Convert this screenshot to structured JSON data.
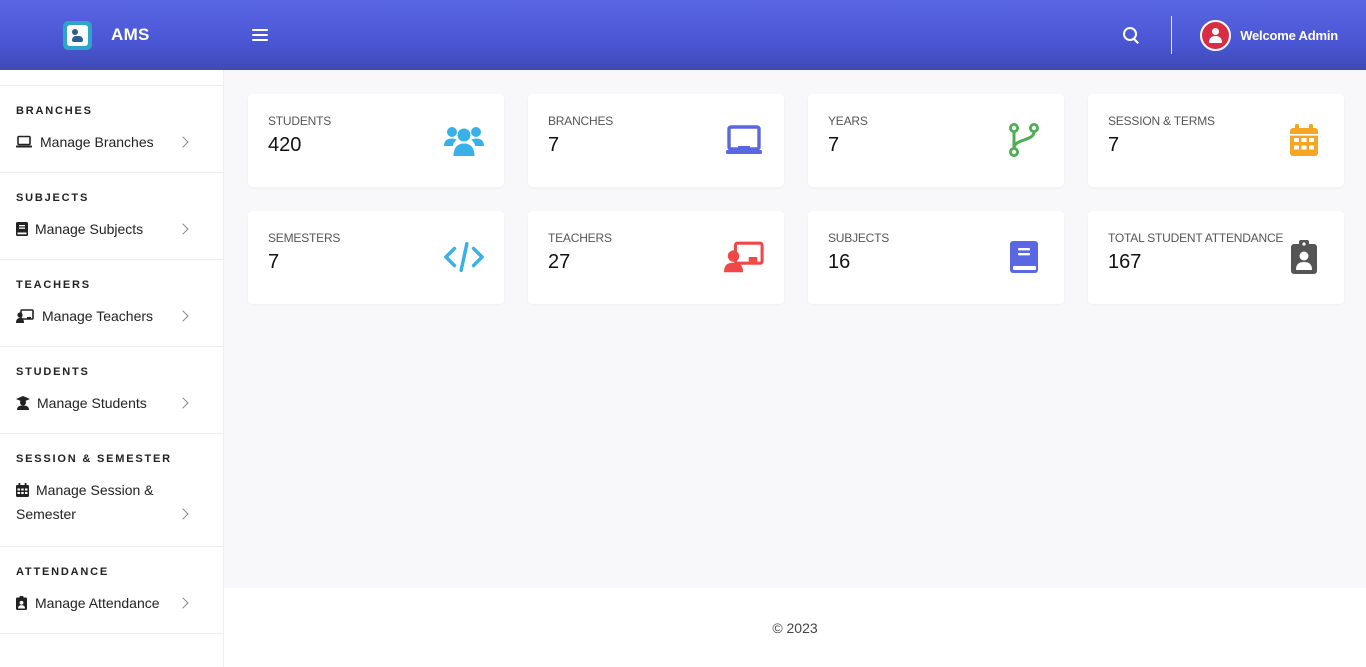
{
  "header": {
    "brand": "AMS",
    "welcome": "Welcome Admin"
  },
  "sidebar": {
    "sections": [
      {
        "title": "BRANCHES",
        "item": "Manage Branches",
        "icon": "laptop-icon"
      },
      {
        "title": "SUBJECTS",
        "item": "Manage Subjects",
        "icon": "book-icon"
      },
      {
        "title": "TEACHERS",
        "item": "Manage Teachers",
        "icon": "chalkboard-teacher-icon"
      },
      {
        "title": "STUDENTS",
        "item": "Manage Students",
        "icon": "graduate-icon"
      },
      {
        "title": "SESSION & SEMESTER",
        "item_line1": "Manage Session &",
        "item_line2": "Semester",
        "icon": "calendar-icon"
      },
      {
        "title": "ATTENDANCE",
        "item": "Manage Attendance",
        "icon": "clipboard-user-icon"
      }
    ]
  },
  "cards": [
    {
      "label": "STUDENTS",
      "value": "420",
      "icon": "users-icon",
      "color": "#3ab0e8"
    },
    {
      "label": "BRANCHES",
      "value": "7",
      "icon": "chalkboard-icon",
      "color": "#5a67e3"
    },
    {
      "label": "YEARS",
      "value": "7",
      "icon": "code-branch-icon",
      "color": "#4caf50"
    },
    {
      "label": "SESSION & TERMS",
      "value": "7",
      "icon": "calendar-icon",
      "color": "#f5a623"
    },
    {
      "label": "SEMESTERS",
      "value": "7",
      "icon": "code-icon",
      "color": "#3ab0e8"
    },
    {
      "label": "TEACHERS",
      "value": "27",
      "icon": "chalkboard-teacher-icon",
      "color": "#f04848"
    },
    {
      "label": "SUBJECTS",
      "value": "16",
      "icon": "book-icon",
      "color": "#5a67e3"
    },
    {
      "label": "TOTAL STUDENT ATTENDANCE",
      "value": "167",
      "icon": "clipboard-user-icon",
      "color": "#555555"
    }
  ],
  "footer": {
    "copyright": "© 2023"
  }
}
